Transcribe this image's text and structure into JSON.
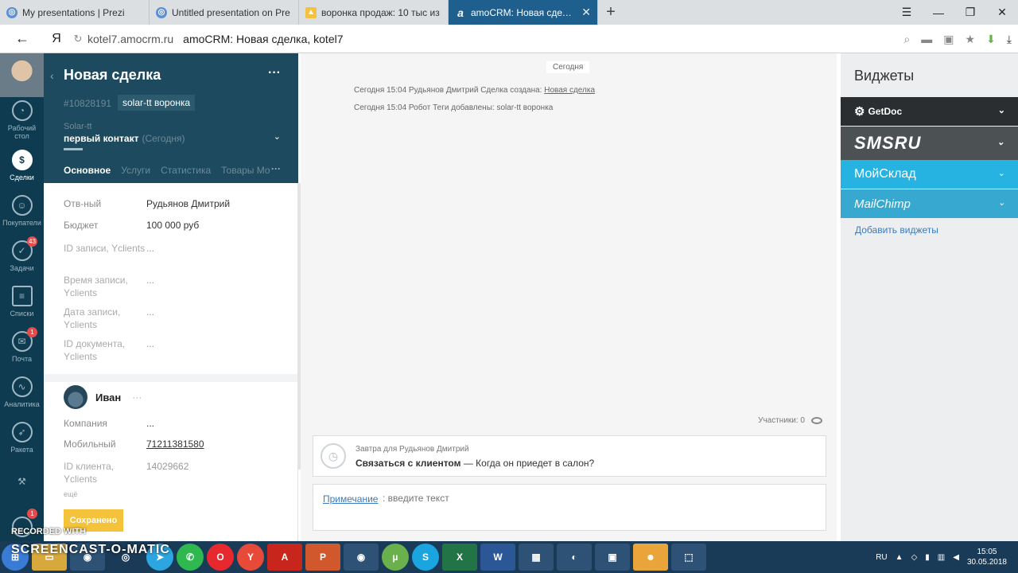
{
  "browser": {
    "tabs": [
      {
        "label": "My presentations | Prezi",
        "active": false
      },
      {
        "label": "Untitled presentation on Pre",
        "active": false
      },
      {
        "label": "воронка продаж: 10 тыс из",
        "active": false
      },
      {
        "label": "amoCRM: Новая сделка",
        "active": true
      }
    ],
    "address_host": "kotel7.amocrm.ru",
    "address_title": "amoCRM: Новая сделка, kotel7",
    "yandex_glyph": "Я"
  },
  "appnav": {
    "items": [
      {
        "label": "Рабочий стол",
        "badge": ""
      },
      {
        "label": "Сделки",
        "badge": ""
      },
      {
        "label": "Покупатели",
        "badge": ""
      },
      {
        "label": "Задачи",
        "badge": "43"
      },
      {
        "label": "Списки",
        "badge": ""
      },
      {
        "label": "Почта",
        "badge": "1"
      },
      {
        "label": "Аналитика",
        "badge": ""
      },
      {
        "label": "Ракета",
        "badge": ""
      },
      {
        "label": "",
        "badge": ""
      },
      {
        "label": "",
        "badge": "1"
      }
    ]
  },
  "deal": {
    "title": "Новая сделка",
    "id": "#10828191",
    "tag": "solar-tt воронка",
    "pipeline": "Solar-tt",
    "stage": "первый контакт",
    "stage_date": "(Сегодня)",
    "tabs": [
      "Основное",
      "Услуги",
      "Статистика",
      "Товары Мо"
    ],
    "fields": [
      {
        "label": "Отв-ный",
        "value": "Рудьянов Дмитрий"
      },
      {
        "label": "Бюджет",
        "value": "100 000 руб"
      },
      {
        "label": "ID записи, Yclients",
        "value": "..."
      },
      {
        "label": "Время записи, Yclients",
        "value": "..."
      },
      {
        "label": "Дата записи, Yclients",
        "value": "..."
      },
      {
        "label": "ID документа, Yclients",
        "value": "..."
      }
    ],
    "contact": {
      "name": "Иван",
      "more": "···",
      "fields": [
        {
          "label": "Компания",
          "value": "..."
        },
        {
          "label": "Мобильный",
          "value": "71211381580"
        },
        {
          "label": "ID клиента, Yclients",
          "value": "14029662"
        }
      ],
      "more_link": "ещё"
    },
    "save_label": "Сохранено"
  },
  "feed": {
    "day": "Сегодня",
    "events": [
      {
        "text": "Сегодня 15:04 Рудьянов Дмитрий  Сделка создана: ",
        "link": "Новая сделка"
      },
      {
        "text": "Сегодня 15:04 Робот  Теги добавлены: solar-tt воронка",
        "link": ""
      }
    ],
    "participants": "Участники: 0",
    "task": {
      "for": "Завтра для Рудьянов Дмитрий",
      "type": "Связаться с клиентом",
      "text": " — Когда он приедет в салон?"
    },
    "note": {
      "label": "Примечание",
      "placeholder": ": введите текст"
    }
  },
  "widgets": {
    "title": "Виджеты",
    "items": [
      {
        "label": "GetDoc"
      },
      {
        "label": "SMSRU"
      },
      {
        "label": "МойСклад"
      },
      {
        "label": "MailChimp"
      }
    ],
    "add_label": "Добавить виджеты"
  },
  "taskbar": {
    "lang": "RU",
    "time": "15:05",
    "date": "30.05.2018",
    "icons": [
      "Telegram",
      "WhatsApp",
      "Opera",
      "Yandex",
      "PDF",
      "PowerPoint",
      "Eye",
      "uTorrent",
      "Skype",
      "Excel",
      "Word",
      "Paint",
      "Media",
      "Photos",
      "Game",
      "Snip"
    ]
  },
  "watermark": {
    "line1": "RECORDED WITH",
    "line2": "SCREENCAST-O-MATIC"
  }
}
